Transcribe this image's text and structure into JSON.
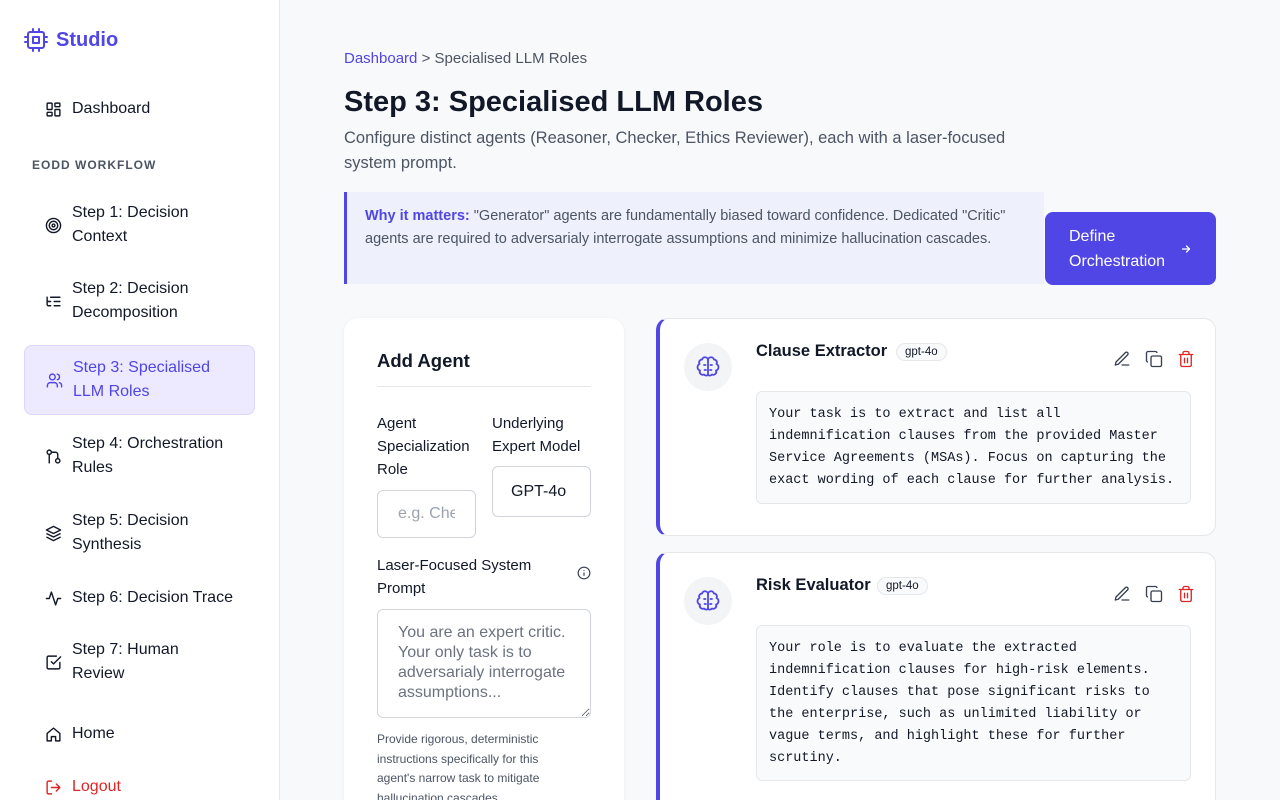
{
  "brand": {
    "name": "Studio"
  },
  "sidebar": {
    "top": {
      "label": "Dashboard"
    },
    "section_label": "EODD WORKFLOW",
    "steps": [
      {
        "line1": "Step 1: Decision",
        "line2": "Context"
      },
      {
        "line1": "Step 2: Decision",
        "line2": "Decomposition"
      },
      {
        "line1": "Step 3: Specialised",
        "line2": "LLM Roles"
      },
      {
        "line1": "Step 4: Orchestration",
        "line2": "Rules"
      },
      {
        "line1": "Step 5: Decision",
        "line2": "Synthesis"
      },
      {
        "line1": "Step 6: Decision Trace"
      },
      {
        "line1": "Step 7: Human Review"
      }
    ],
    "home": "Home",
    "logout": "Logout"
  },
  "breadcrumb": {
    "link": "Dashboard",
    "sep": ">",
    "current": "Specialised LLM Roles"
  },
  "page": {
    "title": "Step 3: Specialised LLM Roles",
    "subtitle": "Configure distinct agents (Reasoner, Checker, Ethics Reviewer), each with a laser-focused system prompt."
  },
  "callout": {
    "lead": "Why it matters:",
    "body": " \"Generator\" agents are fundamentally biased toward confidence. Dedicated \"Critic\" agents are required to adversarialy interrogate assumptions and minimize hallucination cascades."
  },
  "next_button": {
    "label": "Define Orchestration"
  },
  "add_agent": {
    "title": "Add Agent",
    "role_label": "Agent Specialization Role",
    "role_placeholder": "e.g. Checker",
    "model_label": "Underlying Expert Model",
    "model_value": "GPT-4o",
    "prompt_label": "Laser-Focused System Prompt",
    "prompt_placeholder": "You are an expert critic. Your only task is to adversarialy interrogate assumptions...",
    "help": "Provide rigorous, deterministic instructions specifically for this agent's narrow task to mitigate hallucination cascades."
  },
  "agents": [
    {
      "name": "Clause Extractor",
      "model": "gpt-4o",
      "prompt": "Your task is to extract and list all indemnification clauses from the provided Master Service Agreements (MSAs). Focus on capturing the exact wording of each clause for further analysis."
    },
    {
      "name": "Risk Evaluator",
      "model": "gpt-4o",
      "prompt": "Your role is to evaluate the extracted indemnification clauses for high-risk elements. Identify clauses that pose significant risks to the enterprise, such as unlimited liability or vague terms, and highlight these for further scrutiny."
    }
  ],
  "colors": {
    "accent": "#4f46e5",
    "danger": "#dc2626",
    "active_bg": "#ede9fe"
  },
  "icons": {
    "brand": "cpu-icon",
    "dashboard": "layout-grid-icon",
    "steps": [
      "target-icon",
      "list-tree-icon",
      "users-icon",
      "git-branch-icon",
      "layers-icon",
      "activity-icon",
      "check-square-icon"
    ],
    "home": "home-icon",
    "logout": "logout-icon",
    "agent": "brain-icon",
    "actions": [
      "edit-icon",
      "copy-icon",
      "trash-icon"
    ]
  }
}
